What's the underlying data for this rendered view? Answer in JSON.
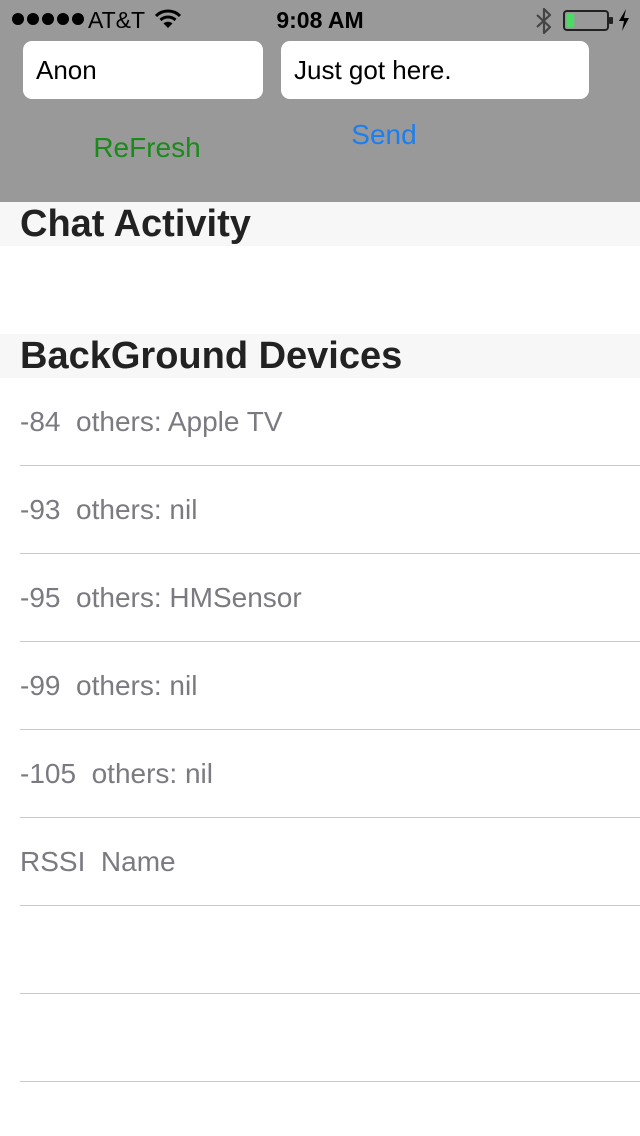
{
  "status_bar": {
    "carrier": "AT&T",
    "time": "9:08 AM",
    "battery_level": 0.2,
    "battery_color": "#4cd964"
  },
  "form": {
    "name_value": "Anon",
    "message_value": "Just got here.",
    "refresh_label": "ReFresh",
    "refresh_color": "#1a8a1a",
    "send_label": "Send",
    "send_color": "#1a7ff0"
  },
  "sections": {
    "chat_title": "Chat Activity",
    "devices_title": "BackGround Devices"
  },
  "devices": [
    {
      "text": "-84  others: Apple TV"
    },
    {
      "text": "-93  others: nil"
    },
    {
      "text": "-95  others: HMSensor"
    },
    {
      "text": "-99  others: nil"
    },
    {
      "text": "-105  others: nil"
    },
    {
      "text": "RSSI  Name"
    },
    {
      "text": ""
    },
    {
      "text": ""
    }
  ]
}
